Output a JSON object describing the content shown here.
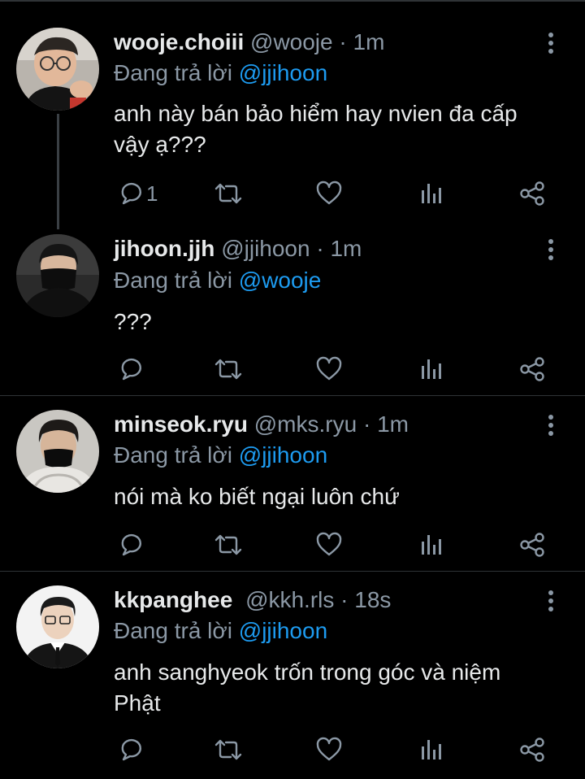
{
  "replying_label": "Đang trả lời",
  "colors": {
    "background": "#000000",
    "text": "#e7e9ea",
    "secondary": "#8b98a5",
    "accent": "#1d9bf0",
    "divider": "#2f3336"
  },
  "tweets": [
    {
      "name": "wooje.choiii",
      "handle": "@wooje",
      "separator": "·",
      "time": "1m",
      "reply_to": "@jjihoon",
      "text": "anh này bán bảo hiểm hay nvien đa cấp vậy ạ???",
      "reply_count": "1"
    },
    {
      "name": "jihoon.jjh",
      "handle": "@jjihoon",
      "separator": "·",
      "time": "1m",
      "reply_to": "@wooje",
      "text": "???",
      "reply_count": ""
    },
    {
      "name": "minseok.ryu",
      "handle": "@mks.ryu",
      "separator": "·",
      "time": "1m",
      "reply_to": "@jjihoon",
      "text": "nói mà ko biết ngại luôn chứ",
      "reply_count": ""
    },
    {
      "name": "kkpanghee",
      "handle": "@kkh.rls",
      "separator": "·",
      "time": "18s",
      "reply_to": "@jjihoon",
      "text": "anh sanghyeok trốn trong góc và niệm Phật",
      "reply_count": ""
    }
  ],
  "icons": [
    "reply-icon",
    "retweet-icon",
    "like-icon",
    "analytics-icon",
    "share-icon",
    "more-options-icon"
  ]
}
